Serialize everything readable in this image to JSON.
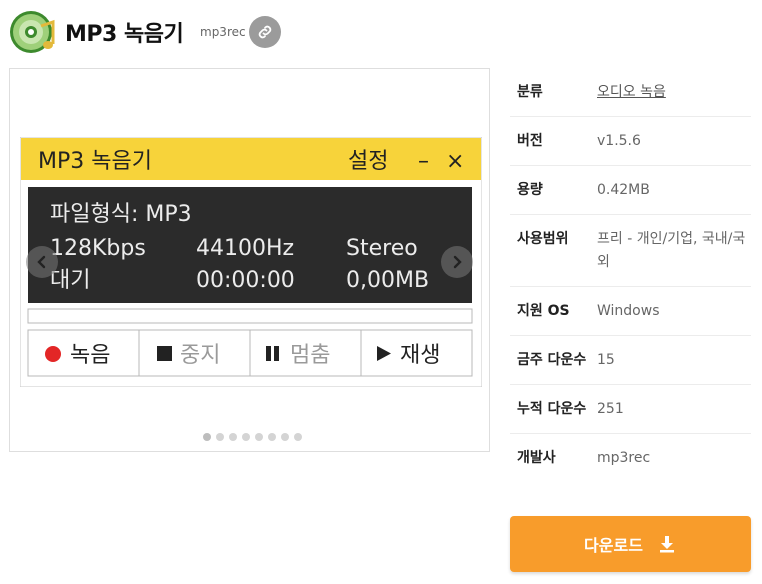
{
  "header": {
    "title": "MP3 녹음기",
    "subtitle": "mp3rec"
  },
  "screenshot": {
    "window_title": "MP3 녹음기",
    "settings_label": "설정",
    "minimize": "–",
    "close": "×",
    "format_line": "파일형식: MP3",
    "bitrate": "128Kbps",
    "samplerate": "44100Hz",
    "channel": "Stereo",
    "status": "대기",
    "time": "00:00:00",
    "size": "0,00MB",
    "buttons": {
      "record": "녹음",
      "stop": "중지",
      "pause": "멈춤",
      "play": "재생"
    }
  },
  "carousel": {
    "total": 8,
    "active": 0
  },
  "info": [
    {
      "key": "분류",
      "value": "오디오 녹음",
      "link": true
    },
    {
      "key": "버전",
      "value": "v1.5.6"
    },
    {
      "key": "용량",
      "value": "0.42MB"
    },
    {
      "key": "사용범위",
      "value": "프리 - 개인/기업, 국내/국외"
    },
    {
      "key": "지원 OS",
      "value": "Windows"
    },
    {
      "key": "금주 다운수",
      "value": "15"
    },
    {
      "key": "누적 다운수",
      "value": "251"
    },
    {
      "key": "개발사",
      "value": "mp3rec"
    }
  ],
  "download_label": "다운로드",
  "colors": {
    "accent": "#f89c2b",
    "titlebar": "#f7d33a",
    "display_bg": "#2b2b2b",
    "record_dot": "#e32626"
  }
}
